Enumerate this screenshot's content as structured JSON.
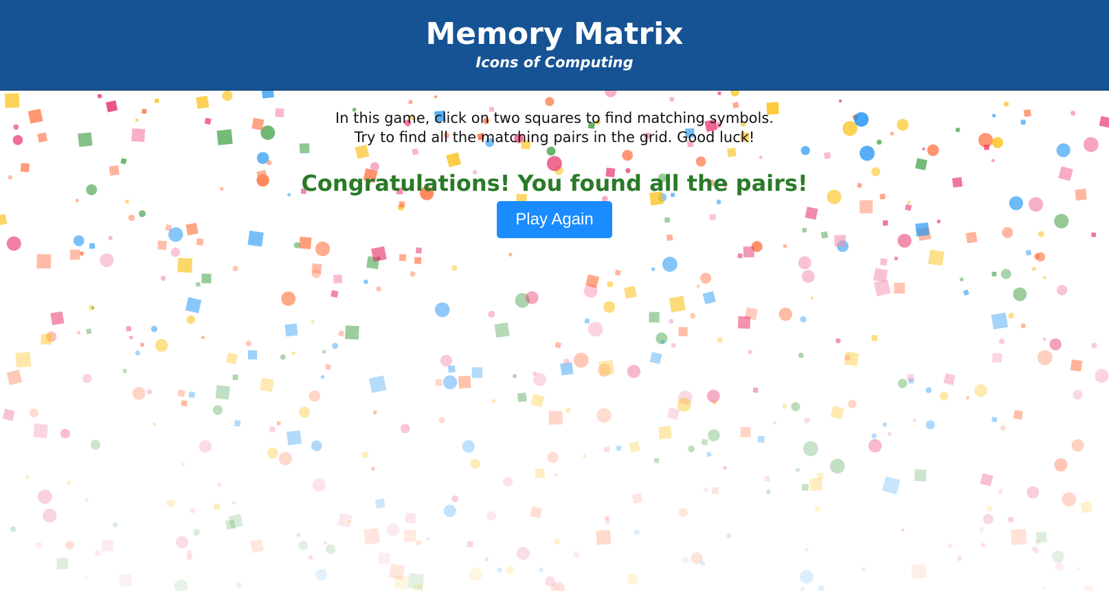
{
  "header": {
    "title": "Memory Matrix",
    "subtitle": "Icons of Computing",
    "background_color": "#155394"
  },
  "main": {
    "instructions": [
      "In this game, click on two squares to find matching symbols.",
      "Try to find all the matching pairs in the grid. Good luck!"
    ],
    "congratulations": "Congratulations! You found all the pairs!",
    "congratulations_color": "#2a7a28",
    "play_again_label": "Play Again",
    "play_again_color": "#1a8cff"
  },
  "confetti": {
    "colors": [
      "#e8336a",
      "#ff5a1f",
      "#fbbf12",
      "#43a047",
      "#2196f3",
      "#f48fb1",
      "#ff8a65"
    ],
    "shapes": [
      "circle",
      "square"
    ]
  }
}
